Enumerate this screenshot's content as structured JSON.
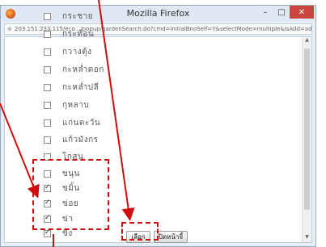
{
  "page_top_text": "...",
  "window": {
    "title": "Mozilla Firefox",
    "url": "203.151.233.115/eco.../popup/gardenSearch.do?cmd=initialBnoSelf=Y&selectMode=multiple&isAdd=add",
    "controls": {
      "minimize": "–",
      "maximize": "□",
      "close": "✕"
    }
  },
  "items": [
    {
      "label": "กระชาย",
      "checked": false
    },
    {
      "label": "กระท้อน",
      "checked": false
    },
    {
      "label": "กวางตุ้ง",
      "checked": false
    },
    {
      "label": "กะหล่ำดอก",
      "checked": false
    },
    {
      "label": "กะหล่ำปลี",
      "checked": false
    },
    {
      "label": "กุหลาบ",
      "checked": false
    },
    {
      "label": "แก่นตะวัน",
      "checked": false
    },
    {
      "label": "แก้วมังกร",
      "checked": false
    },
    {
      "label": "โกสน",
      "checked": false
    },
    {
      "label": "ขนุน",
      "checked": false
    },
    {
      "label": "ขมิ้น",
      "checked": true
    },
    {
      "label": "ข่อย",
      "checked": true
    },
    {
      "label": "ข่า",
      "checked": true
    },
    {
      "label": "ขิง",
      "checked": true
    }
  ],
  "buttons": {
    "select": "เลือก",
    "close": "ปิดหน้าจี้"
  },
  "annotation_color": "#d10c0c"
}
